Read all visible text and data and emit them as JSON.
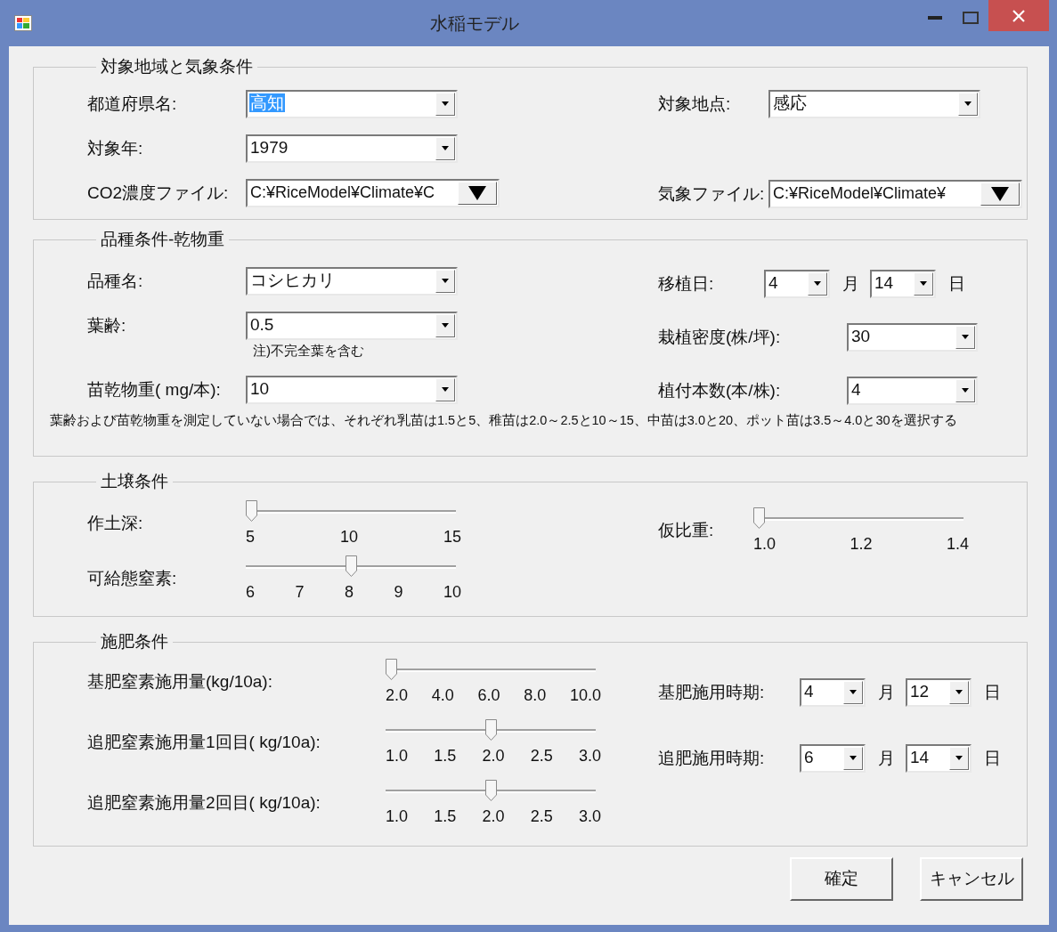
{
  "window": {
    "title": "水稲モデル"
  },
  "groups": [
    {
      "kind": "region",
      "title": "対象地域と気象条件",
      "left": [
        {
          "kind": "combo",
          "label": "都道府県名:",
          "value": "高知",
          "highlighted": true
        },
        {
          "kind": "combo",
          "label": "対象年:",
          "value": "1979",
          "highlighted": false
        },
        {
          "kind": "file",
          "label": "CO2濃度ファイル:",
          "value": "C:¥RiceModel¥Climate¥C"
        }
      ],
      "right": [
        {
          "kind": "combo",
          "label": "対象地点:",
          "value": "感応",
          "highlighted": false
        },
        {
          "kind": "file",
          "label": "気象ファイル:",
          "value": "C:¥RiceModel¥Climate¥"
        }
      ]
    },
    {
      "kind": "variety",
      "title": "品種条件-乾物重",
      "left": [
        {
          "kind": "combo",
          "label": "品種名:",
          "value": "コシヒカリ",
          "highlighted": false
        },
        {
          "kind": "combo",
          "label": "葉齢:",
          "value": "0.5",
          "highlighted": false,
          "note": "注)不完全葉を含む"
        },
        {
          "kind": "combo",
          "label": "苗乾物重( mg/本):",
          "value": "10",
          "highlighted": false
        }
      ],
      "right": [
        {
          "kind": "date",
          "label": "移植日:",
          "month": "4",
          "month_unit": "月",
          "day": "14",
          "day_unit": "日"
        },
        {
          "kind": "combo",
          "label": "栽植密度(株/坪):",
          "value": "30",
          "highlighted": false
        },
        {
          "kind": "combo",
          "label": "植付本数(本/株):",
          "value": "4",
          "highlighted": false
        }
      ],
      "footnote": "葉齢および苗乾物重を測定していない場合では、それぞれ乳苗は1.5と5、稚苗は2.0～2.5と10～15、中苗は3.0と20、ポット苗は3.5～4.0と30を選択する"
    },
    {
      "kind": "soil",
      "title": "土壌条件",
      "left": [
        {
          "kind": "slider",
          "label": "作土深:",
          "level": 0,
          "ticks": [
            "5",
            "10",
            "15"
          ]
        },
        {
          "kind": "slider",
          "label": "可給態窒素:",
          "level": 0.5,
          "ticks": [
            "6",
            "7",
            "8",
            "9",
            "10"
          ]
        }
      ],
      "right": [
        {
          "kind": "slider",
          "label": "仮比重:",
          "level": 0,
          "ticks": [
            "1.0",
            "1.2",
            "1.4"
          ]
        }
      ]
    },
    {
      "kind": "fertilizer",
      "title": "施肥条件",
      "left": [
        {
          "kind": "slider",
          "label": "基肥窒素施用量(kg/10a):",
          "level": 0,
          "ticks": [
            "2.0",
            "4.0",
            "6.0",
            "8.0",
            "10.0"
          ]
        },
        {
          "kind": "slider",
          "label": "追肥窒素施用量1回目( kg/10a):",
          "level": 0.5,
          "ticks": [
            "1.0",
            "1.5",
            "2.0",
            "2.5",
            "3.0"
          ]
        },
        {
          "kind": "slider",
          "label": "追肥窒素施用量2回目( kg/10a):",
          "level": 0.5,
          "ticks": [
            "1.0",
            "1.5",
            "2.0",
            "2.5",
            "3.0"
          ]
        }
      ],
      "right": [
        {
          "kind": "date",
          "label": "基肥施用時期:",
          "month": "4",
          "month_unit": "月",
          "day": "12",
          "day_unit": "日"
        },
        {
          "kind": "date",
          "label": "追肥施用時期:",
          "month": "6",
          "month_unit": "月",
          "day": "14",
          "day_unit": "日"
        }
      ]
    }
  ],
  "buttons": [
    {
      "label": "確定"
    },
    {
      "label": "キャンセル"
    }
  ]
}
